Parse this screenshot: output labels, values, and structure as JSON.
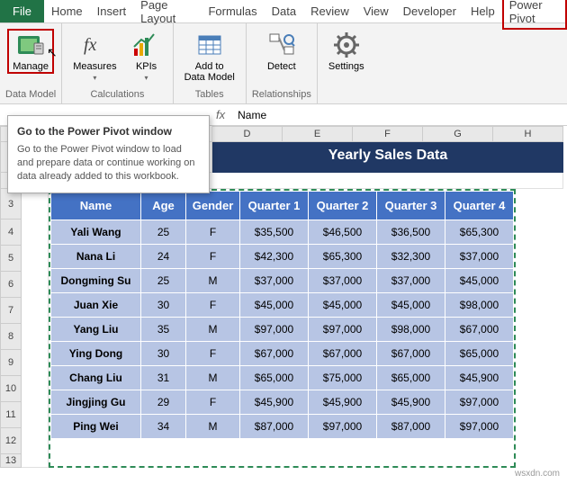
{
  "tabs": {
    "file": "File",
    "items": [
      "Home",
      "Insert",
      "Page Layout",
      "Formulas",
      "Data",
      "Review",
      "View",
      "Developer",
      "Help",
      "Power Pivot"
    ]
  },
  "ribbon": {
    "manage": "Manage",
    "measures": "Measures",
    "kpis": "KPIs",
    "add_to_data_model": "Add to\nData Model",
    "detect": "Detect",
    "settings": "Settings",
    "groups": {
      "data_model": "Data Model",
      "calculations": "Calculations",
      "tables": "Tables",
      "relationships": "Relationships"
    }
  },
  "tooltip": {
    "title": "Go to the Power Pivot window",
    "body": "Go to the Power Pivot window to load and prepare data or continue working on data already added to this workbook."
  },
  "formula_bar": {
    "fx": "fx",
    "value": "Name"
  },
  "columns": [
    "D",
    "E",
    "F",
    "G",
    "H"
  ],
  "row_numbers": [
    "2",
    "3",
    "4",
    "5",
    "6",
    "7",
    "8",
    "9",
    "10",
    "11",
    "12",
    "13"
  ],
  "title_cell": "Yearly Sales Data",
  "headers": [
    "Name",
    "Age",
    "Gender",
    "Quarter 1",
    "Quarter 2",
    "Quarter 3",
    "Quarter 4"
  ],
  "rows": [
    [
      "Yali Wang",
      "25",
      "F",
      "$35,500",
      "$46,500",
      "$36,500",
      "$65,300"
    ],
    [
      "Nana Li",
      "24",
      "F",
      "$42,300",
      "$65,300",
      "$32,300",
      "$37,000"
    ],
    [
      "Dongming Su",
      "25",
      "M",
      "$37,000",
      "$37,000",
      "$37,000",
      "$45,000"
    ],
    [
      "Juan Xie",
      "30",
      "F",
      "$45,000",
      "$45,000",
      "$45,000",
      "$98,000"
    ],
    [
      "Yang Liu",
      "35",
      "M",
      "$97,000",
      "$97,000",
      "$98,000",
      "$67,000"
    ],
    [
      "Ying Dong",
      "30",
      "F",
      "$67,000",
      "$67,000",
      "$67,000",
      "$65,000"
    ],
    [
      "Chang Liu",
      "31",
      "M",
      "$65,000",
      "$75,000",
      "$65,000",
      "$45,900"
    ],
    [
      "Jingjing Gu",
      "29",
      "F",
      "$45,900",
      "$45,900",
      "$45,900",
      "$97,000"
    ],
    [
      "Ping Wei",
      "34",
      "M",
      "$87,000",
      "$97,000",
      "$87,000",
      "$97,000"
    ]
  ],
  "watermark": "wsxdn.com"
}
